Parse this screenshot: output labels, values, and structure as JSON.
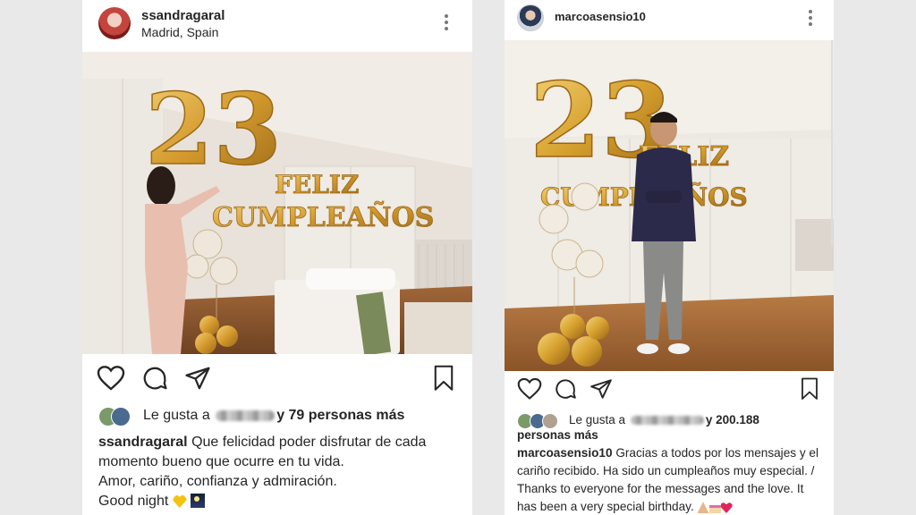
{
  "left_post": {
    "username": "ssandragaral",
    "location": "Madrid, Spain",
    "likes": {
      "prefix": "Le gusta a",
      "suffix": "y 79 personas más"
    },
    "caption": {
      "username": "ssandragaral",
      "line1": "Que felicidad poder disfrutar de cada momento bueno que ocurre en tu vida.",
      "line2": "Amor, cariño, confianza y admiración.",
      "line3": "Good night"
    },
    "photo": {
      "balloon_number": "23",
      "balloon_text_1": "FELIZ",
      "balloon_text_2": "CUMPLEAÑOS"
    }
  },
  "right_post": {
    "username": "marcoasensio10",
    "likes": {
      "prefix": "Le gusta a",
      "suffix": "y 200.188 personas más"
    },
    "caption": {
      "username": "marcoasensio10",
      "text": "Gracias a todos por los mensajes y el cariño recibido. Ha sido un cumpleaños muy especial. / Thanks to everyone for the messages and the love. It has been a very special birthday."
    },
    "photo": {
      "balloon_number": "23",
      "balloon_text_1": "FELIZ",
      "balloon_text_2": "CUMPLEAÑOS"
    }
  },
  "icons": [
    "heart-icon",
    "comment-icon",
    "share-icon",
    "bookmark-icon",
    "more-options-icon"
  ],
  "colors": {
    "gold": "#d4a23a",
    "text": "#262626",
    "background": "#e9e9e9"
  }
}
